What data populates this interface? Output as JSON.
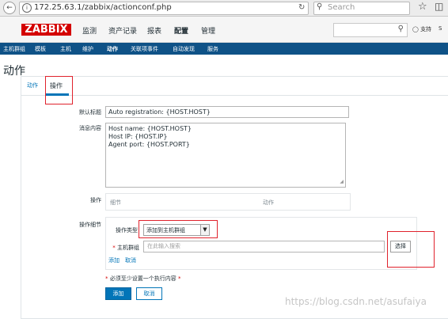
{
  "browser": {
    "url": "172.25.63.1/zabbix/actionconf.php",
    "search_placeholder": "Search"
  },
  "header": {
    "logo": "ZABBIX",
    "menu": [
      "监测",
      "资产记录",
      "报表",
      "配置",
      "管理"
    ],
    "support": "支持",
    "share": "S"
  },
  "submenu": [
    "主机群组",
    "模板",
    "主机",
    "维护",
    "动作",
    "关联项事件",
    "自动发现",
    "服务"
  ],
  "page": {
    "title": "动作"
  },
  "tabs": [
    "动作",
    "操作"
  ],
  "form": {
    "default_subject_label": "默认标题",
    "default_subject_value": "Auto registration: {HOST.HOST}",
    "default_message_label": "消息内容",
    "default_message_lines": [
      "Host name: {HOST.HOST}",
      "Host IP: {HOST.IP}",
      "Agent port: {HOST.PORT}"
    ],
    "operations_label": "操作",
    "operations_col_details": "细节",
    "operations_col_action": "动作",
    "op_details_label": "操作细节",
    "op_type_label": "操作类型",
    "op_type_value": "添加到主机群组",
    "host_group_label": "主机群组",
    "host_group_placeholder": "在此输入搜索",
    "select_button": "选择",
    "add_link": "添加",
    "cancel_link": "取消",
    "required_note": "必须至少设置一个执行内容",
    "add_button": "添加",
    "cancel_button": "取消"
  },
  "watermark": "https://blog.csdn.net/asufaiya"
}
